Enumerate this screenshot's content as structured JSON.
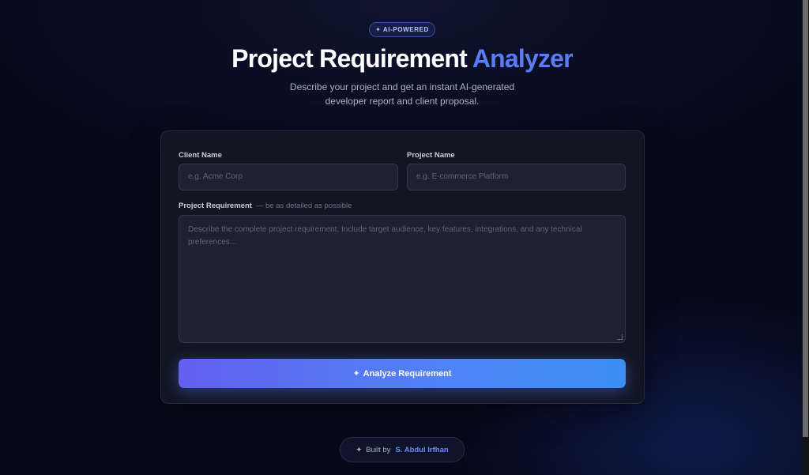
{
  "hero": {
    "badge": "✦ AI-POWERED",
    "title_main": "Project Requirement ",
    "title_accent": "Analyzer",
    "subtitle_line1": "Describe your project and get an instant AI-generated",
    "subtitle_line2": "developer report and client proposal."
  },
  "form": {
    "client_name_label": "Client Name",
    "client_name_placeholder": "e.g. Acme Corp",
    "project_name_label": "Project Name",
    "project_name_placeholder": "e.g. E-commerce Platform",
    "requirement_label": "Project Requirement",
    "requirement_hint": "— be as detailed as possible",
    "requirement_placeholder": "Describe the complete project requirement. Include target audience, key features, integrations, and any technical preferences...",
    "submit_icon": "✦",
    "submit_label": "Analyze Requirement"
  },
  "footer": {
    "icon": "✦",
    "built_by": "Built by",
    "author": "S. Abdul Irfhan"
  },
  "colors": {
    "background": "#06091a",
    "accent": "#5b7cf6",
    "button_start": "#6360f0",
    "button_end": "#3b8ef3"
  }
}
